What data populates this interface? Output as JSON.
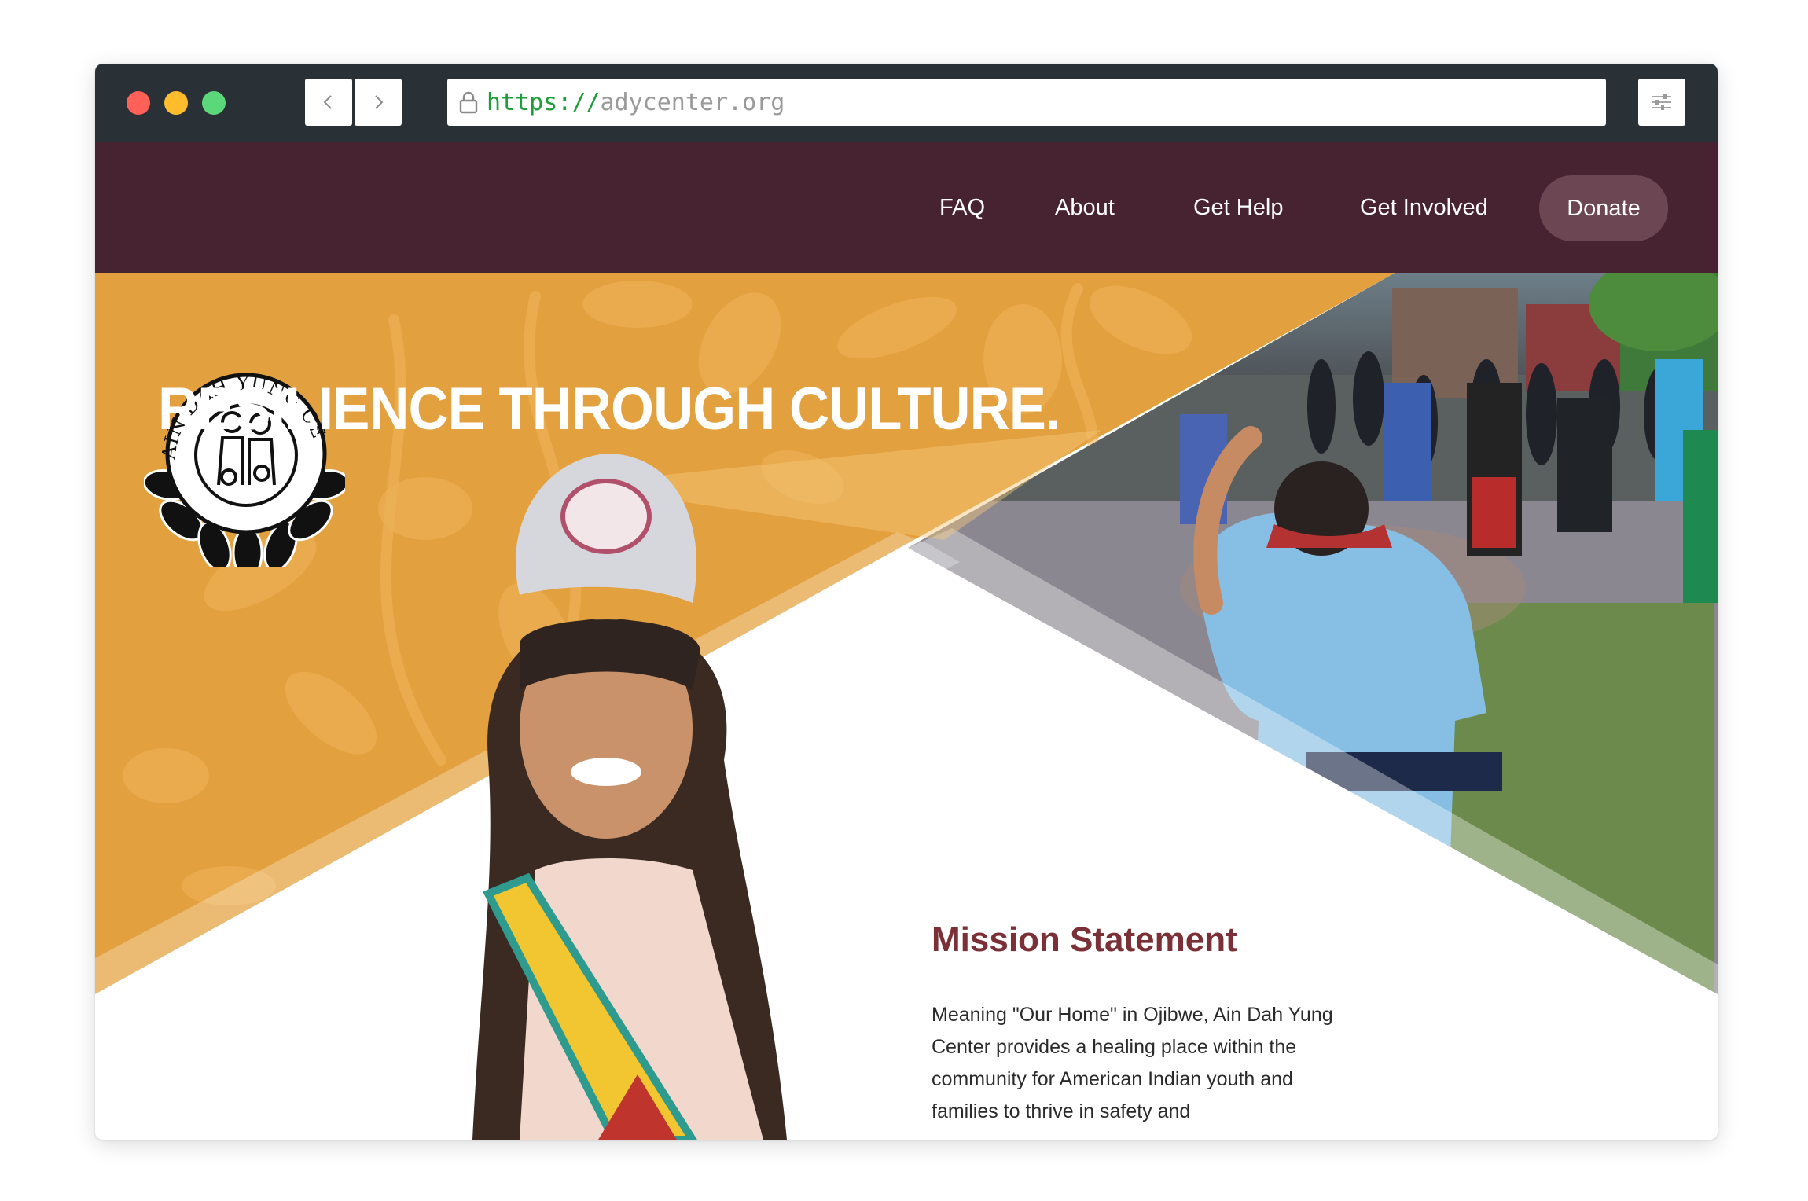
{
  "browser": {
    "url_scheme": "https://",
    "url_host": "adycenter.org"
  },
  "logo": {
    "name": "AIN DAH YUNG CENTER"
  },
  "nav": {
    "items": [
      "FAQ",
      "About",
      "Get Help",
      "Get Involved"
    ],
    "donate_label": "Donate"
  },
  "hero": {
    "tagline": "RESILIENCE THROUGH CULTURE."
  },
  "mission": {
    "title": "Mission Statement",
    "body": "Meaning \"Our Home\" in Ojibwe, Ain Dah Yung Center provides a healing place within the community for American Indian youth and families to thrive in safety and"
  },
  "colors": {
    "header": "#472230",
    "gold": "#e3a03e",
    "mission_title": "#7b2f36",
    "donate_bg": "#6c4753"
  },
  "icons": [
    "lock-icon",
    "chevron-left-icon",
    "chevron-right-icon",
    "sliders-icon"
  ]
}
